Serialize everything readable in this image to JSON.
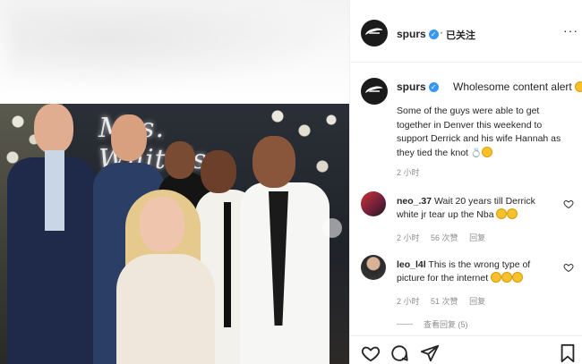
{
  "post": {
    "username": "spurs",
    "follow_status": "已关注",
    "dot": "·",
    "more": "···",
    "caption_headline": "Wholesome content alert",
    "caption_body": "Some of the guys were able to get together in Denver this weekend to support Derrick and his wife Hannah as they tied the knot",
    "caption_time": "2 小时"
  },
  "photo": {
    "neon_text": "Mrs. Whiteʼs"
  },
  "comments": [
    {
      "username": "neo_.37",
      "text": "Wait 20 years till Derrick white jr tear up the Nba",
      "time": "2 小时",
      "likes": "56 次赞",
      "reply": "回复"
    },
    {
      "username": "leo_l4l",
      "text": "This is the wrong type of picture for the internet",
      "time": "2 小时",
      "likes": "51 次赞",
      "reply": "回复"
    }
  ],
  "view_replies": "查看回复 (5)",
  "colors": {
    "verified": "#3897f0",
    "text": "#262626",
    "muted": "#8e8e8e"
  },
  "icons": [
    "heart-icon",
    "comment-icon",
    "share-icon",
    "bookmark-icon",
    "more-icon",
    "verified-icon"
  ]
}
